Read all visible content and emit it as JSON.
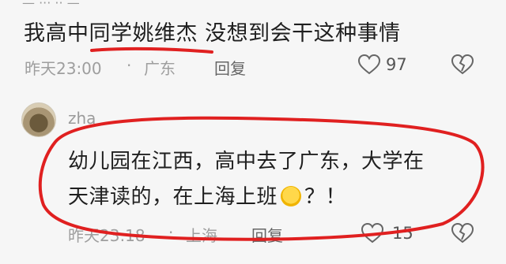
{
  "comment1": {
    "text": "我高中同学姚维杰 没想到会干这种事情",
    "time": "昨天23:00",
    "separator": "·",
    "location": "广东",
    "reply_label": "回复",
    "likes": "97"
  },
  "comment2": {
    "username": "zha",
    "line1": "幼儿园在江西，高中去了广东，大学在",
    "line2_before": "天津读的，在上海上班",
    "line2_after": "？！",
    "time": "昨天23:18",
    "separator": "·",
    "location": "上海",
    "reply_label": "回复",
    "likes": "15"
  },
  "icons": {
    "like": "heart-outline-icon",
    "dislike": "broken-heart-icon",
    "emoji": "laughing-crying-emoji"
  },
  "colors": {
    "annotation_red": "#e02020",
    "meta_gray": "#9e9e9e",
    "background": "#f6f6f6"
  }
}
